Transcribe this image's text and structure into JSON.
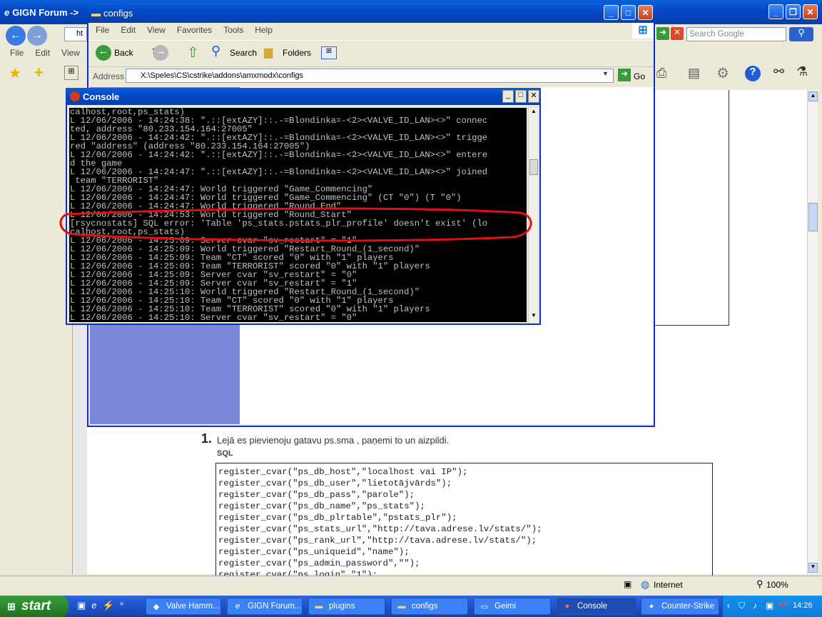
{
  "ie": {
    "title": "GIGN Forum ->",
    "menu": [
      "File",
      "Edit",
      "View"
    ],
    "search_placeholder": "Search Google",
    "addr_prefix": "ht"
  },
  "explorer": {
    "title": "configs",
    "menu": [
      "File",
      "Edit",
      "View",
      "Favorites",
      "Tools",
      "Help"
    ],
    "back_label": "Back",
    "search_label": "Search",
    "folders_label": "Folders",
    "address_label": "Address",
    "address_value": "X:\\Speles\\CS\\cstrike\\addons\\amxmodx\\configs",
    "go_label": "Go"
  },
  "console": {
    "title": "Console",
    "lines": [
      "calhost,root,ps_stats)",
      "L 12/06/2006 - 14:24:38: \".::[extAZY]::.-=Blondinka=-<2><VALVE_ID_LAN><>\" connec",
      "ted, address \"80.233.154.164:27005\"",
      "L 12/06/2006 - 14:24:42: \".::[extAZY]::.-=Blondinka=-<2><VALVE_ID_LAN><>\" trigge",
      "red \"address\" (address \"80.233.154.164:27005\")",
      "L 12/06/2006 - 14:24:42: \".::[extAZY]::.-=Blondinka=-<2><VALVE_ID_LAN><>\" entere",
      "d the game",
      "L 12/06/2006 - 14:24:47: \".::[extAZY]::.-=Blondinka=-<2><VALVE_ID_LAN><>\" joined",
      " team \"TERRORIST\"",
      "L 12/06/2006 - 14:24:47: World triggered \"Game_Commencing\"",
      "L 12/06/2006 - 14:24:47: World triggered \"Game_Commencing\" (CT \"0\") (T \"0\")",
      "L 12/06/2006 - 14:24:47: World triggered \"Round_End\"",
      "L 12/06/2006 - 14:24:53: World triggered \"Round_Start\"",
      "[rsycnostats] SQL error: 'Table 'ps_stats.pstats_plr_profile' doesn't exist' (lo",
      "calhost,root,ps_stats)",
      "L 12/06/2006 - 14:25:09: Server cvar \"sv_restart\" = \"1\"",
      "L 12/06/2006 - 14:25:09: World triggered \"Restart_Round_(1_second)\"",
      "L 12/06/2006 - 14:25:09: Team \"CT\" scored \"0\" with \"1\" players",
      "L 12/06/2006 - 14:25:09: Team \"TERRORIST\" scored \"0\" with \"1\" players",
      "L 12/06/2006 - 14:25:09: Server cvar \"sv_restart\" = \"0\"",
      "L 12/06/2006 - 14:25:09: Server cvar \"sv_restart\" = \"1\"",
      "L 12/06/2006 - 14:25:10: World triggered \"Restart_Round_(1_second)\"",
      "L 12/06/2006 - 14:25:10: Team \"CT\" scored \"0\" with \"1\" players",
      "L 12/06/2006 - 14:25:10: Team \"TERRORIST\" scored \"0\" with \"1\" players",
      "L 12/06/2006 - 14:25:10: Server cvar \"sv_restart\" = \"0\""
    ]
  },
  "page": {
    "step_number": "1.",
    "step_text": "Lejā es pievienoju gatavu ps.sma , paņemi to un aizpildi.",
    "code_label": "SQL",
    "code_lines": [
      "register_cvar(\"ps_db_host\",\"localhost vai IP\");",
      "register_cvar(\"ps_db_user\",\"lietotājvārds\");",
      "register_cvar(\"ps_db_pass\",\"parole\");",
      "register_cvar(\"ps_db_name\",\"ps_stats\");",
      "register_cvar(\"ps_db_plrtable\",\"pstats_plr\");",
      "register_cvar(\"ps_stats_url\",\"http://tava.adrese.lv/stats/\");",
      "register_cvar(\"ps_rank_url\",\"http://tava.adrese.lv/stats/\");",
      "register_cvar(\"ps_uniqueid\",\"name\");",
      "register_cvar(\"ps_admin_password\",\"\");",
      "register_cvar(\"ps_login\",\"1\");"
    ]
  },
  "status": {
    "zone": "Internet",
    "zoom": "100%"
  },
  "taskbar": {
    "start": "start",
    "items": [
      "Valve Hamm...",
      "GIGN Forum...",
      "plugins",
      "configs",
      "Geimi",
      "Console",
      "Counter-Strike"
    ],
    "clock": "14:26"
  }
}
